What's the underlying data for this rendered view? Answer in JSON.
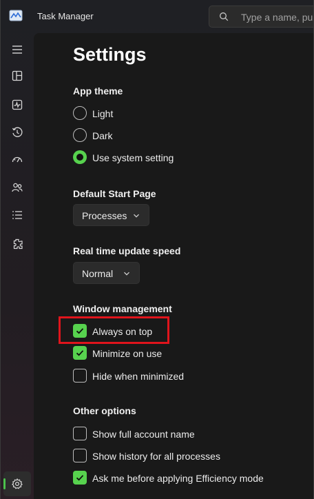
{
  "app": {
    "title": "Task Manager",
    "search_placeholder": "Type a name, pub"
  },
  "nav": {
    "items": [
      {
        "icon": "hamburger-menu-icon"
      },
      {
        "icon": "processes-icon"
      },
      {
        "icon": "performance-icon"
      },
      {
        "icon": "app-history-icon"
      },
      {
        "icon": "startup-apps-icon"
      },
      {
        "icon": "users-icon"
      },
      {
        "icon": "details-icon"
      },
      {
        "icon": "services-icon"
      },
      {
        "icon": "settings-icon",
        "active": true
      }
    ]
  },
  "settings": {
    "title": "Settings",
    "app_theme": {
      "label": "App theme",
      "options": [
        "Light",
        "Dark",
        "Use system setting"
      ],
      "selected": "Use system setting"
    },
    "default_start_page": {
      "label": "Default Start Page",
      "value": "Processes"
    },
    "update_speed": {
      "label": "Real time update speed",
      "value": "Normal"
    },
    "window_management": {
      "label": "Window management",
      "options": [
        {
          "label": "Always on top",
          "checked": true
        },
        {
          "label": "Minimize on use",
          "checked": true
        },
        {
          "label": "Hide when minimized",
          "checked": false
        }
      ]
    },
    "other_options": {
      "label": "Other options",
      "options": [
        {
          "label": "Show full account name",
          "checked": false
        },
        {
          "label": "Show history for all processes",
          "checked": false
        },
        {
          "label": "Ask me before applying Efficiency mode",
          "checked": true
        }
      ]
    }
  },
  "colors": {
    "accent": "#57d24e",
    "highlight": "#e0141c",
    "background": "#191919"
  }
}
